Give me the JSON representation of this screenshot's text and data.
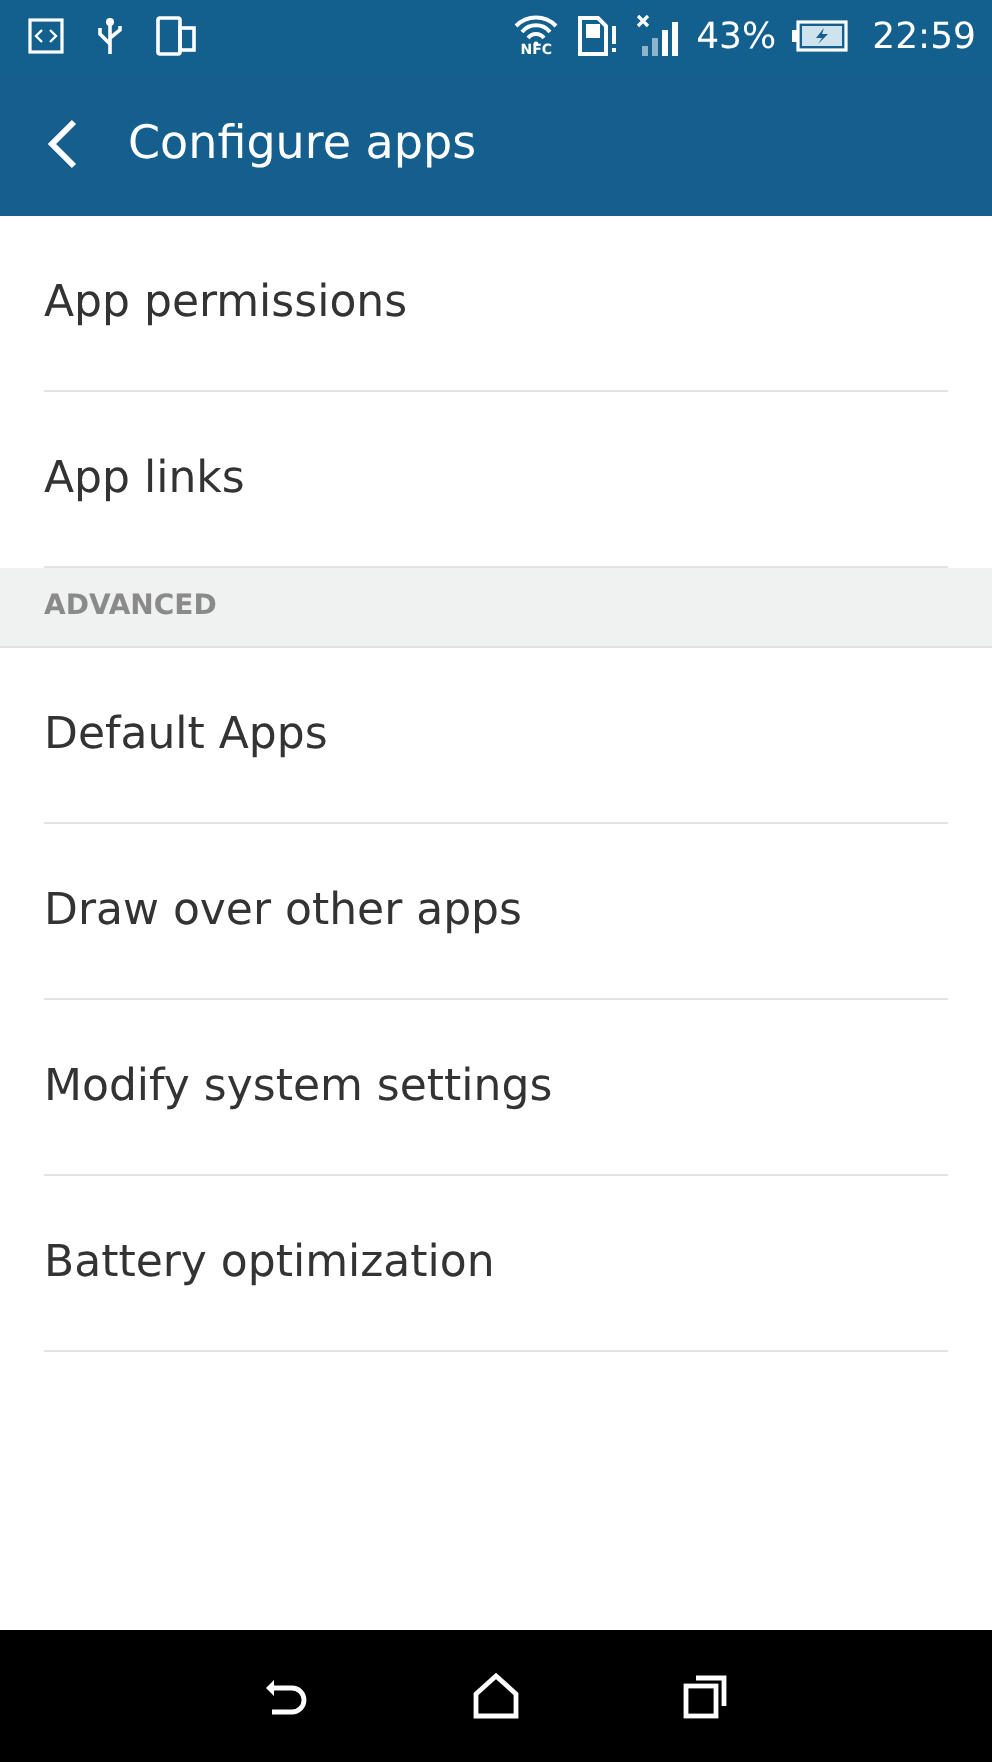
{
  "status_bar": {
    "nfc_label": "NFC",
    "battery": "43%",
    "time": "22:59"
  },
  "app_bar": {
    "title": "Configure apps"
  },
  "sections": [
    {
      "items": [
        "App permissions",
        "App links"
      ]
    },
    {
      "header": "ADVANCED",
      "items": [
        "Default Apps",
        "Draw over other apps",
        "Modify system settings",
        "Battery optimization"
      ]
    }
  ]
}
